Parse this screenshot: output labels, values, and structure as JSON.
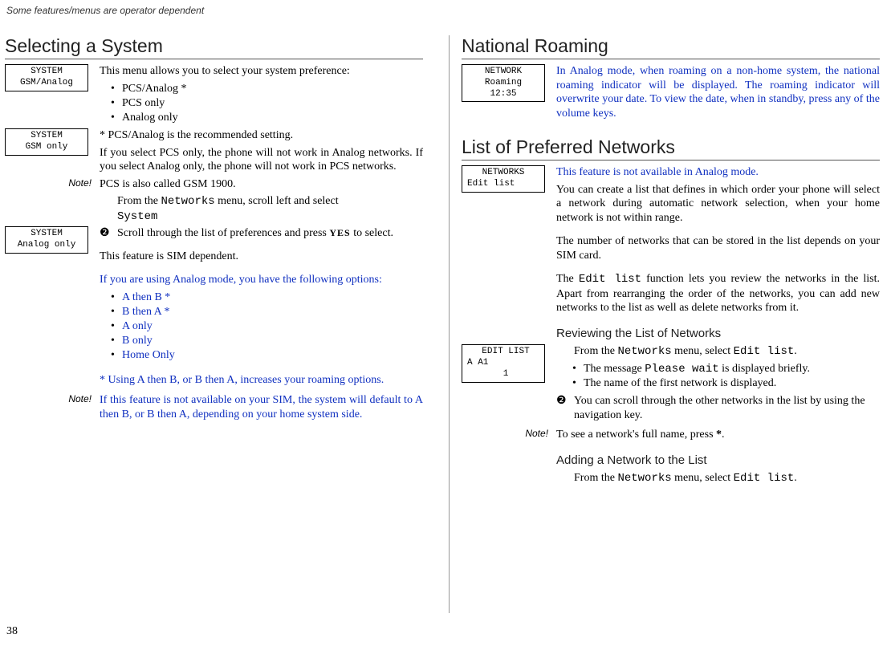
{
  "topnote": "Some features/menus are operator dependent",
  "pagenum": "38",
  "left": {
    "h1": "Selecting a System",
    "screen1": {
      "l1": "SYSTEM",
      "l2": "GSM/Analog"
    },
    "p1": "This menu allows you to select your system preference:",
    "opts": {
      "a": "PCS/Analog *",
      "b": "PCS only",
      "c": "Analog only"
    },
    "screen2": {
      "l1": "SYSTEM",
      "l2": "GSM only"
    },
    "p2a": "* PCS/Analog is the recommended setting.",
    "p2b": "If you select PCS only, the phone will not work in Analog networks. If you select Analog only, the phone will not work in PCS networks.",
    "note1_label": "Note!",
    "note1": "PCS is also called GSM 1900.",
    "step1a": "From the ",
    "step1b": "Networks",
    "step1c": " menu, scroll left and select ",
    "step1d": "System",
    "screen3": {
      "l1": "SYSTEM",
      "l2": "Analog only"
    },
    "step2num": "❷",
    "step2a": "Scroll through the list of preferences and press ",
    "step2b": "YES",
    "step2c": " to select.",
    "p3": "This feature is SIM dependent.",
    "p4": "If you are using Analog mode, you have the following options:",
    "aopts": {
      "a": "A then B *",
      "b": "B then A *",
      "c": "A only",
      "d": "B only",
      "e": "Home Only"
    },
    "p5": "* Using A then B, or B then A, increases your roaming options.",
    "note2_label": "Note!",
    "note2": "If  this feature is not available on your SIM, the system will default to A then B, or B then A, depending on your home system side."
  },
  "right": {
    "h1a": "National Roaming",
    "screenA": {
      "l1": "NETWORK",
      "l2": "Roaming",
      "l3": "12:35"
    },
    "pA": "In  Analog mode, when roaming on a non-home system, the national roaming indicator will be displayed. The roaming indicator will overwrite your date. To view the date, when in standby, press any of the volume keys.",
    "h1b": "List of Preferred Networks",
    "screenB": {
      "l1": "NETWORKS",
      "l2": "Edit list"
    },
    "pB1": "This feature is not available in Analog mode.",
    "pB2": "You can create a list that defines in which order your phone will select a network during automatic network selection, when your  home network is not within range.",
    "pB3": "The number of networks that can be stored in the list depends on your SIM card.",
    "pB4a": "The ",
    "pB4b": "Edit list",
    "pB4c": " function lets you review the networks in the list. Apart from rearranging the order of the networks, you can add new networks to the list as well as delete networks from it.",
    "h2a": "Reviewing the List of Networks",
    "screenC": {
      "l1": "EDIT LIST",
      "l2": "A A1",
      "l3": "1"
    },
    "stepR1a": "From the ",
    "stepR1b": "Networks",
    "stepR1c": " menu, select ",
    "stepR1d": "Edit list",
    "stepR1e": ".",
    "sub1a": "The message ",
    "sub1b": "Please wait",
    "sub1c": " is displayed briefly.",
    "sub2": "The name of the first network is displayed.",
    "stepR2num": "❷",
    "stepR2": "You can scroll through the other networks in the list by using the navigation key.",
    "note3_label": "Note!",
    "note3a": "To see a network's full name, press ",
    "note3b": "*",
    "note3c": ".",
    "h2b": "Adding a Network to the List",
    "stepA1a": "From the ",
    "stepA1b": "Networks",
    "stepA1c": " menu, select ",
    "stepA1d": "Edit list",
    "stepA1e": "."
  }
}
